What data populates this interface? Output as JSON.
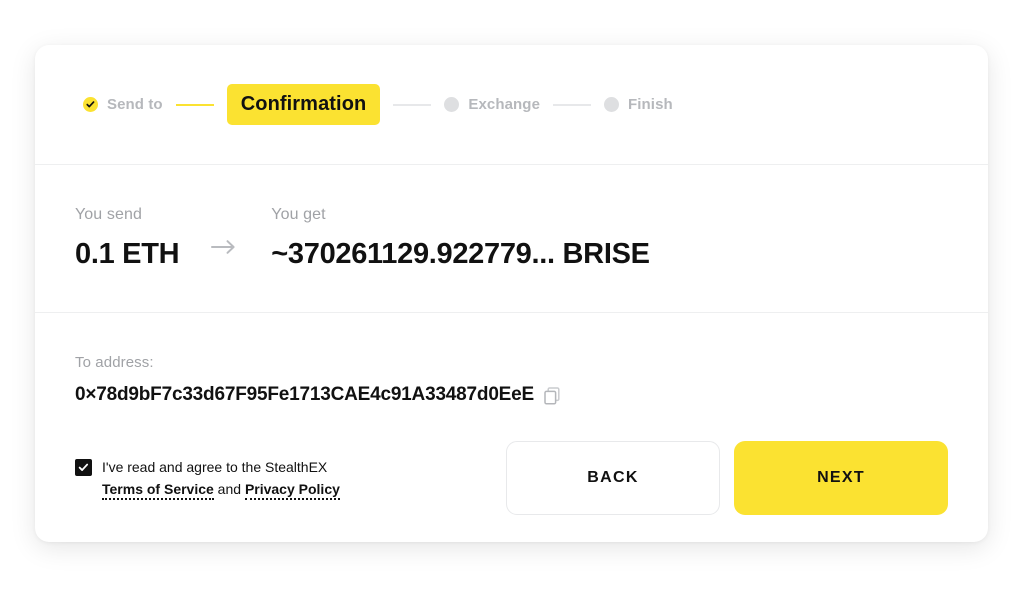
{
  "theme": {
    "accent_yellow": "#FBE231",
    "text_dark": "#111111",
    "text_muted": "#A0A2A6",
    "step_inactive": "#DEDFE1",
    "divider": "#EEEFF0",
    "page_background": "#FFFFFF"
  },
  "stepper": {
    "steps": [
      {
        "label": "Send to",
        "state": "done",
        "icon": "check-icon"
      },
      {
        "label": "Confirmation",
        "state": "active",
        "icon": ""
      },
      {
        "label": "Exchange",
        "state": "pending",
        "icon": ""
      },
      {
        "label": "Finish",
        "state": "pending",
        "icon": ""
      }
    ]
  },
  "exchange": {
    "send_label": "You send",
    "send_value": "0.1 ETH",
    "arrow_icon": "arrow-right-icon",
    "get_label": "You get",
    "get_value": "~370261129.922779... BRISE"
  },
  "address": {
    "label": "To address:",
    "value": "0×78d9bF7c33d67F95Fe1713CAE4c91A33487d0EeE",
    "copy_icon": "copy-icon"
  },
  "terms": {
    "checked": true,
    "line1": "I've read and agree to the StealthEX",
    "terms_of_service": "Terms of Service",
    "and": "and",
    "privacy_policy": "Privacy Policy"
  },
  "actions": {
    "back_label": "BACK",
    "next_label": "NEXT"
  }
}
